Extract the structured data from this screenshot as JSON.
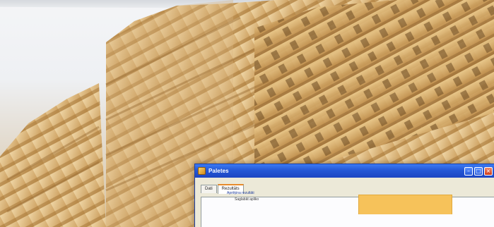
{
  "window": {
    "title": "Paletes",
    "icon": "app-icon",
    "controls": [
      "minimize-icon",
      "maximize-icon",
      "close-icon"
    ]
  },
  "tabs": [
    {
      "label": "Dati",
      "active": false
    },
    {
      "label": "Rezultāts",
      "active": true
    }
  ],
  "results": {
    "group_title": "Aprēķina rezultāti",
    "field_label": "Saglabāt apliko"
  },
  "colors": {
    "titlebar": "#2457d6",
    "result_box": "#f6c25a",
    "pallet_wood": "#d9b47a"
  }
}
